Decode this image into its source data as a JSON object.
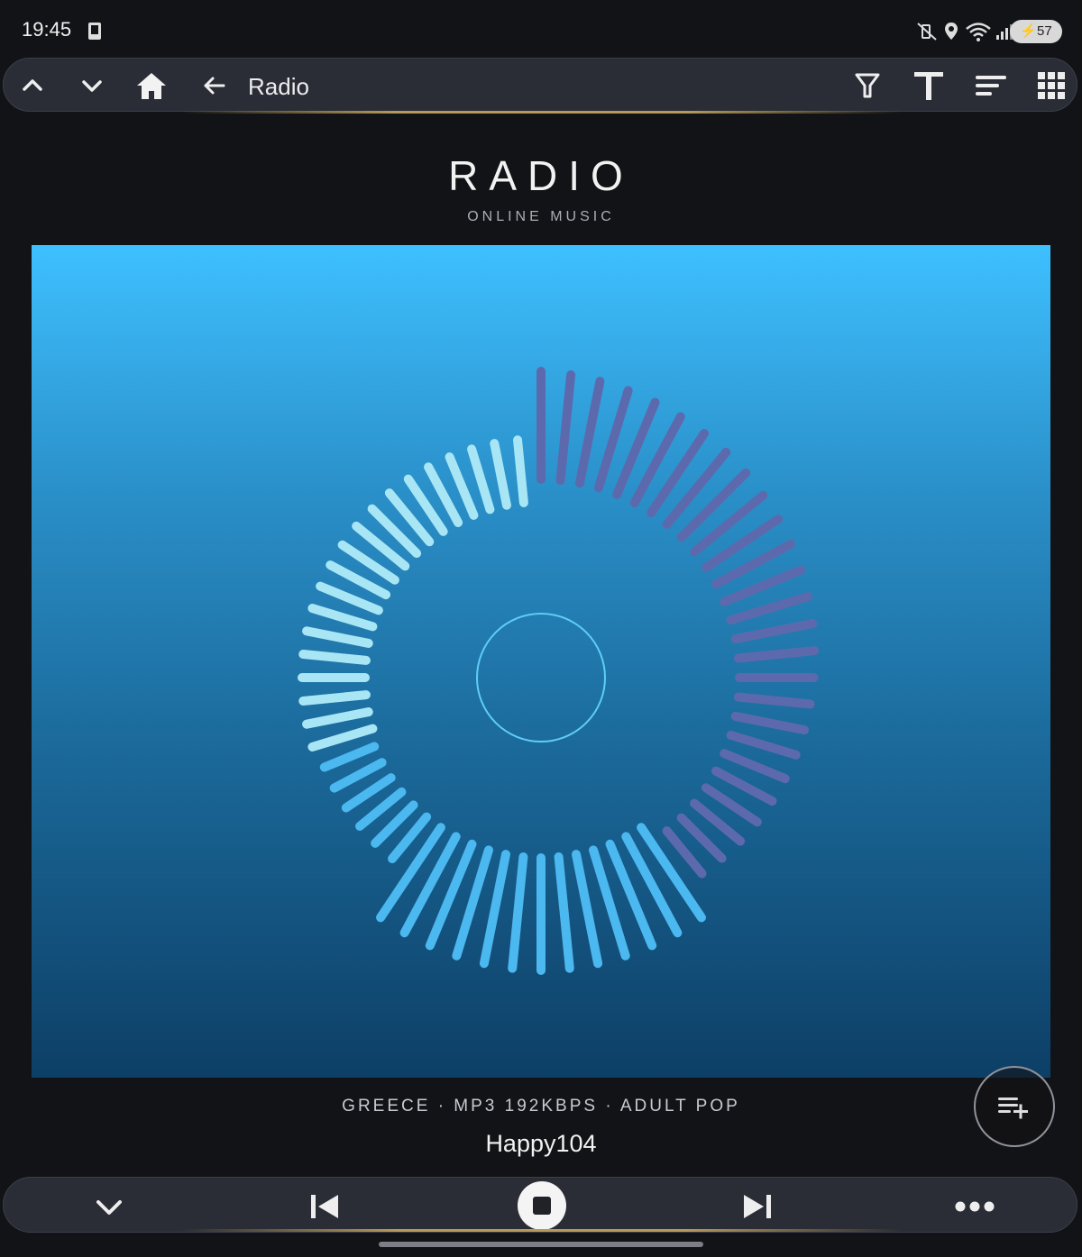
{
  "status": {
    "time": "19:45",
    "battery": "57"
  },
  "toolbar": {
    "title": "Radio"
  },
  "header": {
    "title": "RADIO",
    "subtitle": "ONLINE MUSIC"
  },
  "station": {
    "meta": "GREECE · MP3 192KBPS · ADULT POP",
    "name": "Happy104"
  },
  "icons": {
    "up": "chevron-up-icon",
    "down": "chevron-down-icon",
    "home": "home-icon",
    "back": "arrow-left-icon",
    "filter": "filter-icon",
    "text": "text-size-icon",
    "sort": "sort-icon",
    "grid": "grid-icon",
    "queue": "add-to-queue-icon",
    "collapse": "chevron-down-icon",
    "prev": "skip-previous-icon",
    "stop": "stop-icon",
    "next": "skip-next-icon",
    "more": "more-icon"
  },
  "colors": {
    "art_top": "#3ec0ff",
    "art_bottom": "#0d3f66",
    "bar_light": "#a9e6f5",
    "bar_purple": "#5c6aad",
    "bar_blue": "#4bb8f0"
  }
}
